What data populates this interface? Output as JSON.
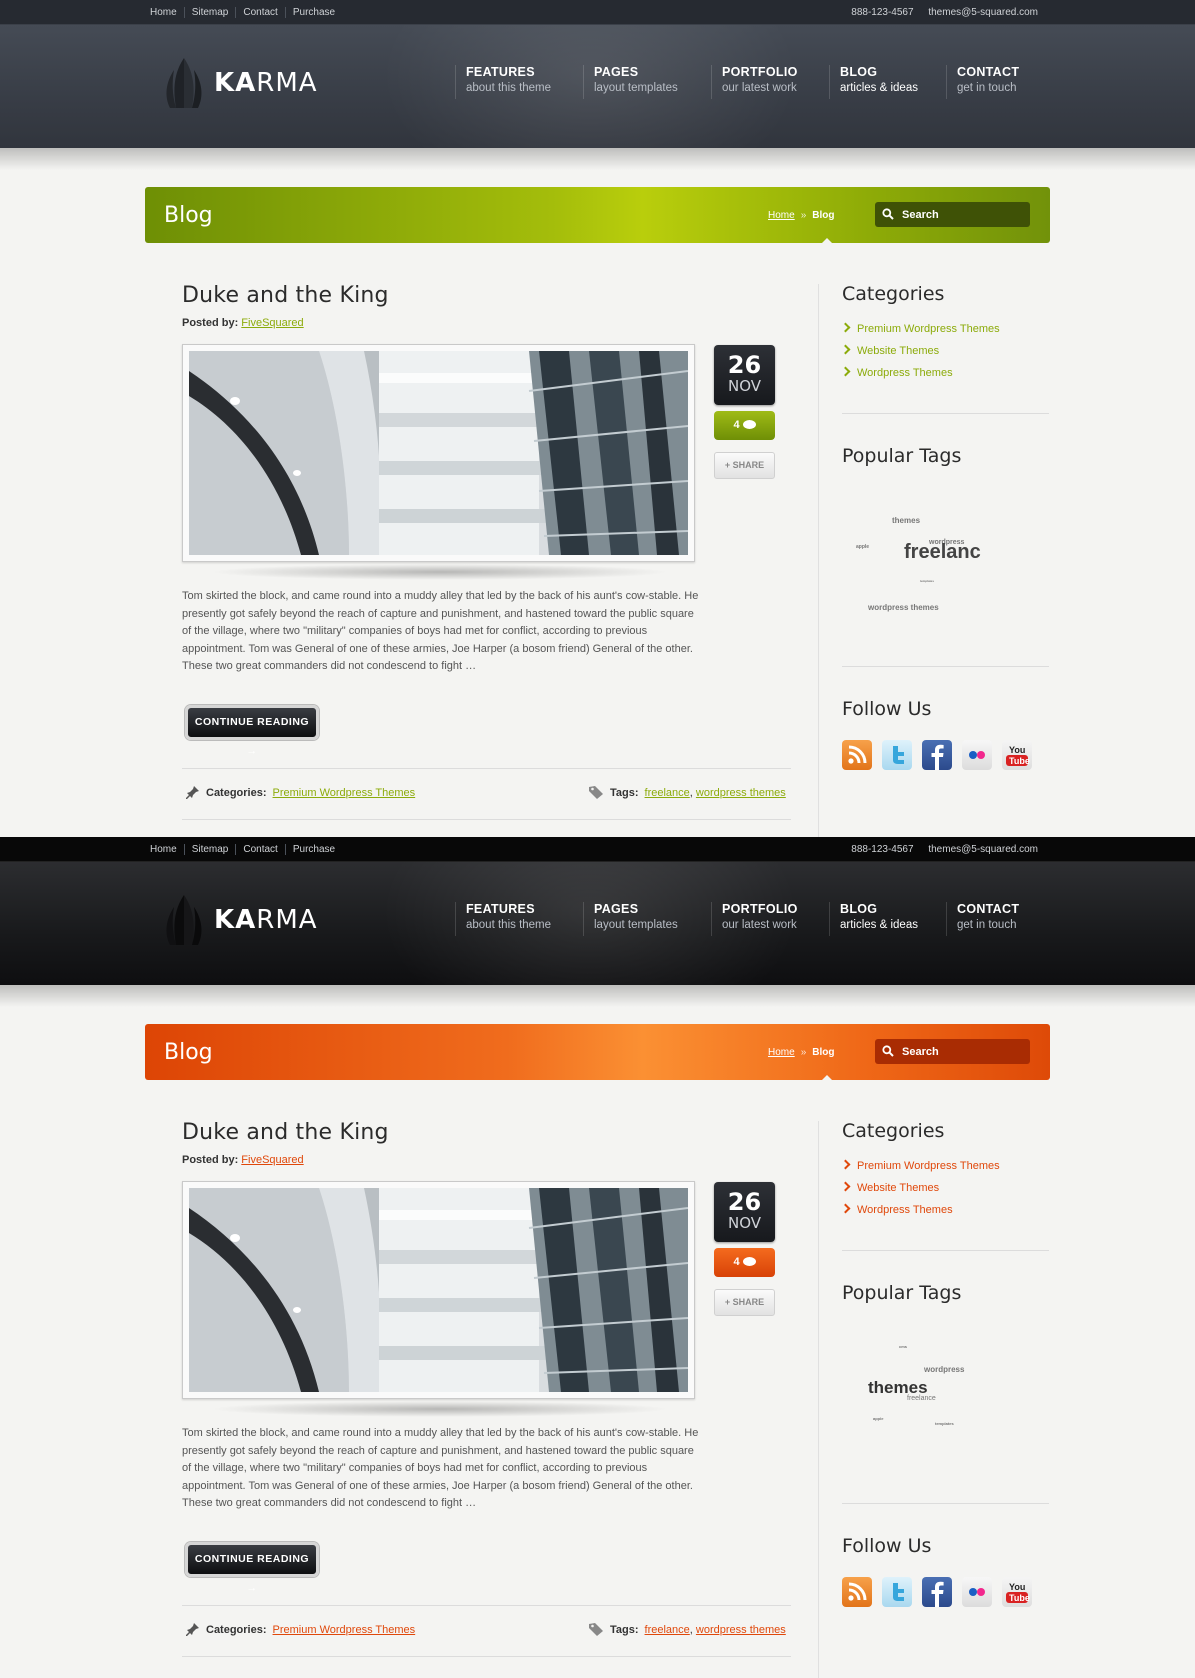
{
  "topbar": {
    "links": [
      "Home",
      "Sitemap",
      "Contact",
      "Purchase"
    ],
    "phone": "888-123-4567",
    "email": "themes@5-squared.com"
  },
  "logo": {
    "text_bold": "KA",
    "text_light": "RMA"
  },
  "nav": [
    {
      "title": "FEATURES",
      "sub": "about this theme"
    },
    {
      "title": "PAGES",
      "sub": "layout templates"
    },
    {
      "title": "PORTFOLIO",
      "sub": "our latest work"
    },
    {
      "title": "BLOG",
      "sub": "articles & ideas"
    },
    {
      "title": "CONTACT",
      "sub": "get in touch"
    }
  ],
  "banner": {
    "title": "Blog",
    "breadcrumb_home": "Home",
    "breadcrumb_sep": "»",
    "breadcrumb_current": "Blog",
    "search_placeholder": "Search"
  },
  "post": {
    "title": "Duke and the King",
    "posted_by_label": "Posted by:",
    "author": "FiveSquared",
    "day": "26",
    "month": "NOV",
    "comments": "4",
    "share_label": "+ SHARE",
    "excerpt": "Tom skirted the block, and came round into a muddy alley that led by the back of his aunt's cow-stable. He presently got safely beyond the reach of capture and punishment, and hastened toward the public square of the village, where two \"military\" companies of boys had met for conflict, according to previous appointment. Tom was General of one of these armies, Joe Harper (a bosom friend) General of the other. These two great commanders did not condescend to fight …",
    "continue_label": "CONTINUE READING →",
    "categories_label": "Categories:",
    "category": "Premium Wordpress Themes",
    "tags_label": "Tags:",
    "tag1": "freelance",
    "tag_comma": ",",
    "tag2": "wordpress themes"
  },
  "sidebar": {
    "categories_title": "Categories",
    "categories": [
      "Premium Wordpress Themes",
      "Website Themes",
      "Wordpress Themes"
    ],
    "tags_title": "Popular Tags",
    "follow_title": "Follow Us"
  },
  "tag_cloud_green": [
    {
      "text": "themes",
      "size": 8
    },
    {
      "text": "apple",
      "size": 5
    },
    {
      "text": "wordpress",
      "size": 7
    },
    {
      "text": "freelanc",
      "size": 20
    },
    {
      "text": "templates",
      "size": 3
    },
    {
      "text": "wordpress themes",
      "size": 8
    }
  ],
  "tag_cloud_orange": [
    {
      "text": "cms",
      "size": 4
    },
    {
      "text": "wordpress",
      "size": 8
    },
    {
      "text": "themes",
      "size": 17
    },
    {
      "text": "freelance",
      "size": 7
    },
    {
      "text": "apple",
      "size": 4
    },
    {
      "text": "templates",
      "size": 4
    }
  ],
  "social": [
    "rss-icon",
    "twitter-icon",
    "facebook-icon",
    "flickr-icon",
    "youtube-icon"
  ],
  "youtube_text": {
    "you": "You",
    "tube": "Tube"
  },
  "colors": {
    "green_accent": "#8cab0a",
    "orange_accent": "#e0480b",
    "header_dark": "#383d46",
    "header_black": "#18191b"
  }
}
